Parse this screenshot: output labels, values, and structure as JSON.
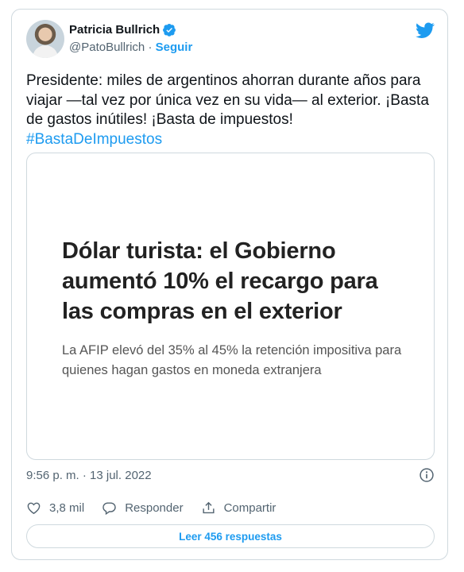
{
  "author": {
    "name": "Patricia Bullrich",
    "handle": "@PatoBullrich",
    "separator": "·",
    "follow_label": "Seguir"
  },
  "tweet": {
    "text": "Presidente: miles de argentinos ahorran durante años para viajar —tal vez por única vez en su vida— al exterior. ¡Basta de gastos inútiles! ¡Basta de impuestos!",
    "hashtag": "#BastaDeImpuestos"
  },
  "card": {
    "title": "Dólar turista: el Gobierno aumentó 10% el recargo para las compras en el exterior",
    "subtitle": "La AFIP elevó del 35% al 45% la retención impositiva para quienes hagan gastos en moneda extranjera"
  },
  "meta": {
    "timestamp": "9:56 p. m. · 13 jul. 2022"
  },
  "actions": {
    "likes": "3,8 mil",
    "reply_label": "Responder",
    "share_label": "Compartir"
  },
  "read_replies_label": "Leer 456 respuestas",
  "colors": {
    "accent": "#1d9bf0",
    "text": "#0f1419",
    "muted": "#536471",
    "border": "#cfd9de"
  },
  "icons": [
    "verified-badge-icon",
    "twitter-bird-icon",
    "info-icon",
    "heart-icon",
    "reply-icon",
    "share-icon"
  ]
}
